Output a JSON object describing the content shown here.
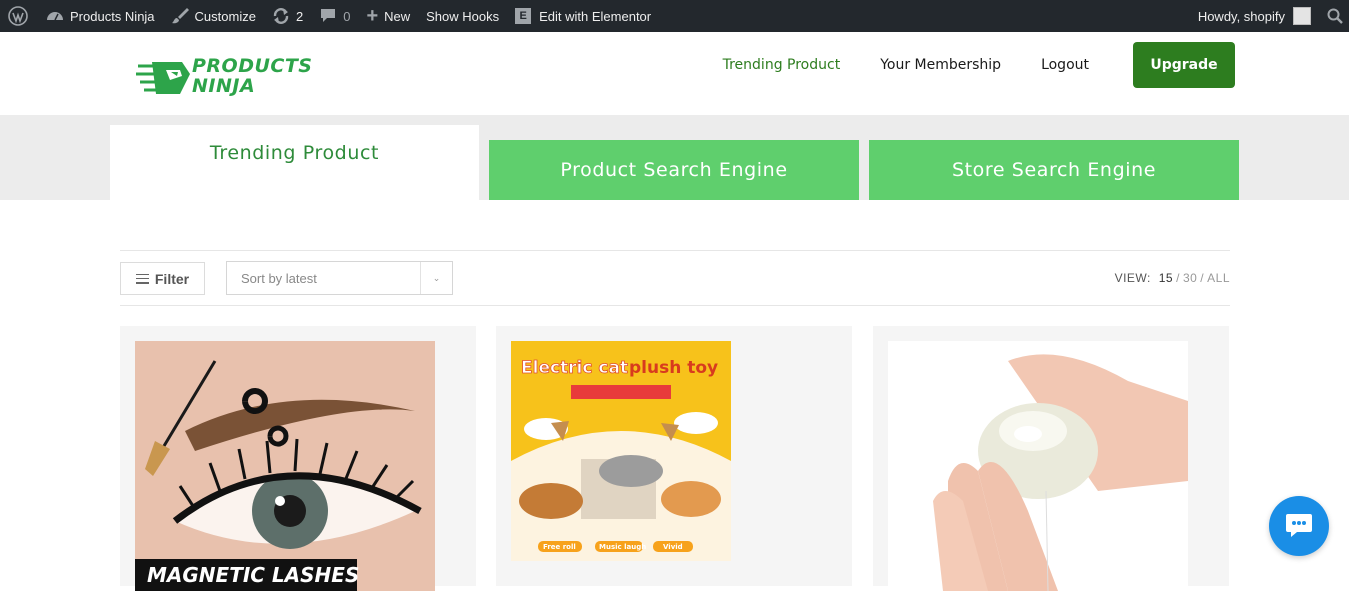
{
  "admin_bar": {
    "wp_logo_icon": "wordpress-icon",
    "site_name": "Products Ninja",
    "customize": "Customize",
    "updates_count": "2",
    "comments_count": "0",
    "new_label": "New",
    "show_hooks": "Show Hooks",
    "edit_elementor": "Edit with Elementor",
    "howdy": "Howdy, shopify"
  },
  "header": {
    "logo_line1": "PRODUCTS",
    "logo_line2": "NINJA",
    "nav": [
      "Trending Product",
      "Your Membership",
      "Logout"
    ],
    "upgrade": "Upgrade",
    "active_color": "#2e7d1f"
  },
  "tabs": [
    "Trending Product",
    "Product Search Engine",
    "Store Search Engine"
  ],
  "toolbar": {
    "filter": "Filter",
    "sort_value": "Sort by latest",
    "view_label": "VIEW:",
    "view_options": [
      "15",
      "30",
      "ALL"
    ]
  },
  "products": [
    {
      "banner_text": "MAGNETIC LASHES"
    },
    {
      "title_part1": "Electric cat",
      "title_part2": "plush toy",
      "badges": [
        "Free roll",
        "Music laugh",
        "Vivid"
      ]
    },
    {}
  ],
  "colors": {
    "admin_bg": "#23282d",
    "brand_green": "#2da44a",
    "tab_green": "#5fcf6d",
    "upgrade_green": "#2d7d1f",
    "chat_blue": "#1a8ee6"
  }
}
